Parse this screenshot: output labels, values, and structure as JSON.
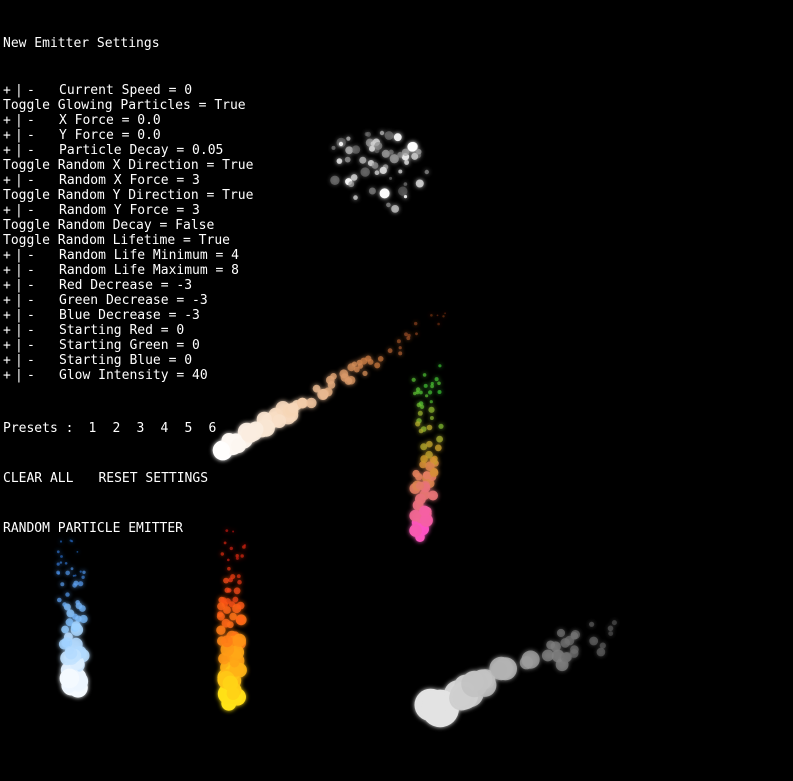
{
  "panel": {
    "title": "New Emitter Settings",
    "rows": [
      {
        "type": "pm",
        "label": "Current Speed = 0"
      },
      {
        "type": "toggle",
        "label": "Toggle Glowing Particles = True"
      },
      {
        "type": "pm",
        "label": "X Force = 0.0"
      },
      {
        "type": "pm",
        "label": "Y Force = 0.0"
      },
      {
        "type": "pm",
        "label": "Particle Decay = 0.05"
      },
      {
        "type": "toggle",
        "label": "Toggle Random X Direction = True"
      },
      {
        "type": "pm",
        "label": "Random X Force = 3"
      },
      {
        "type": "toggle",
        "label": "Toggle Random Y Direction = True"
      },
      {
        "type": "pm",
        "label": "Random Y Force = 3"
      },
      {
        "type": "toggle",
        "label": "Toggle Random Decay = False"
      },
      {
        "type": "toggle",
        "label": "Toggle Random Lifetime = True"
      },
      {
        "type": "pm",
        "label": "Random Life Minimum = 4"
      },
      {
        "type": "pm",
        "label": "Random Life Maximum = 8"
      },
      {
        "type": "pm",
        "label": "Red Decrease = -3"
      },
      {
        "type": "pm",
        "label": "Green Decrease = -3"
      },
      {
        "type": "pm",
        "label": "Blue Decrease = -3"
      },
      {
        "type": "pm",
        "label": "Starting Red = 0"
      },
      {
        "type": "pm",
        "label": "Starting Green = 0"
      },
      {
        "type": "pm",
        "label": "Starting Blue = 0"
      },
      {
        "type": "pm",
        "label": "Glow Intensity = 40"
      }
    ],
    "plus_label": "+",
    "bar_label": "|",
    "minus_label": "-",
    "presets_label": "Presets :",
    "presets": [
      "1",
      "2",
      "3",
      "4",
      "5",
      "6"
    ],
    "clear_all_label": "CLEAR ALL",
    "reset_settings_label": "RESET SETTINGS",
    "random_emitter_label": "RANDOM PARTICLE EMITTER"
  },
  "emitters": [
    {
      "name": "gray-cluster",
      "colors": [
        "#6a6a6a",
        "#b4b4b4",
        "#ffffff"
      ]
    },
    {
      "name": "brown-peach-trail",
      "colors": [
        "#7a2a10",
        "#c8763c",
        "#f5d2b0",
        "#ffffff"
      ]
    },
    {
      "name": "green-magenta-trail",
      "colors": [
        "#3ce63c",
        "#d29628",
        "#ff50c8"
      ]
    },
    {
      "name": "blue-fountain",
      "colors": [
        "#2878e6",
        "#8cc8ff",
        "#ffffff"
      ]
    },
    {
      "name": "red-yellow-fountain",
      "colors": [
        "#e61414",
        "#ff6414",
        "#ffe614"
      ]
    },
    {
      "name": "gray-smoke-trail",
      "colors": [
        "#505050",
        "#a0a0a0",
        "#e6e6e6"
      ]
    }
  ]
}
